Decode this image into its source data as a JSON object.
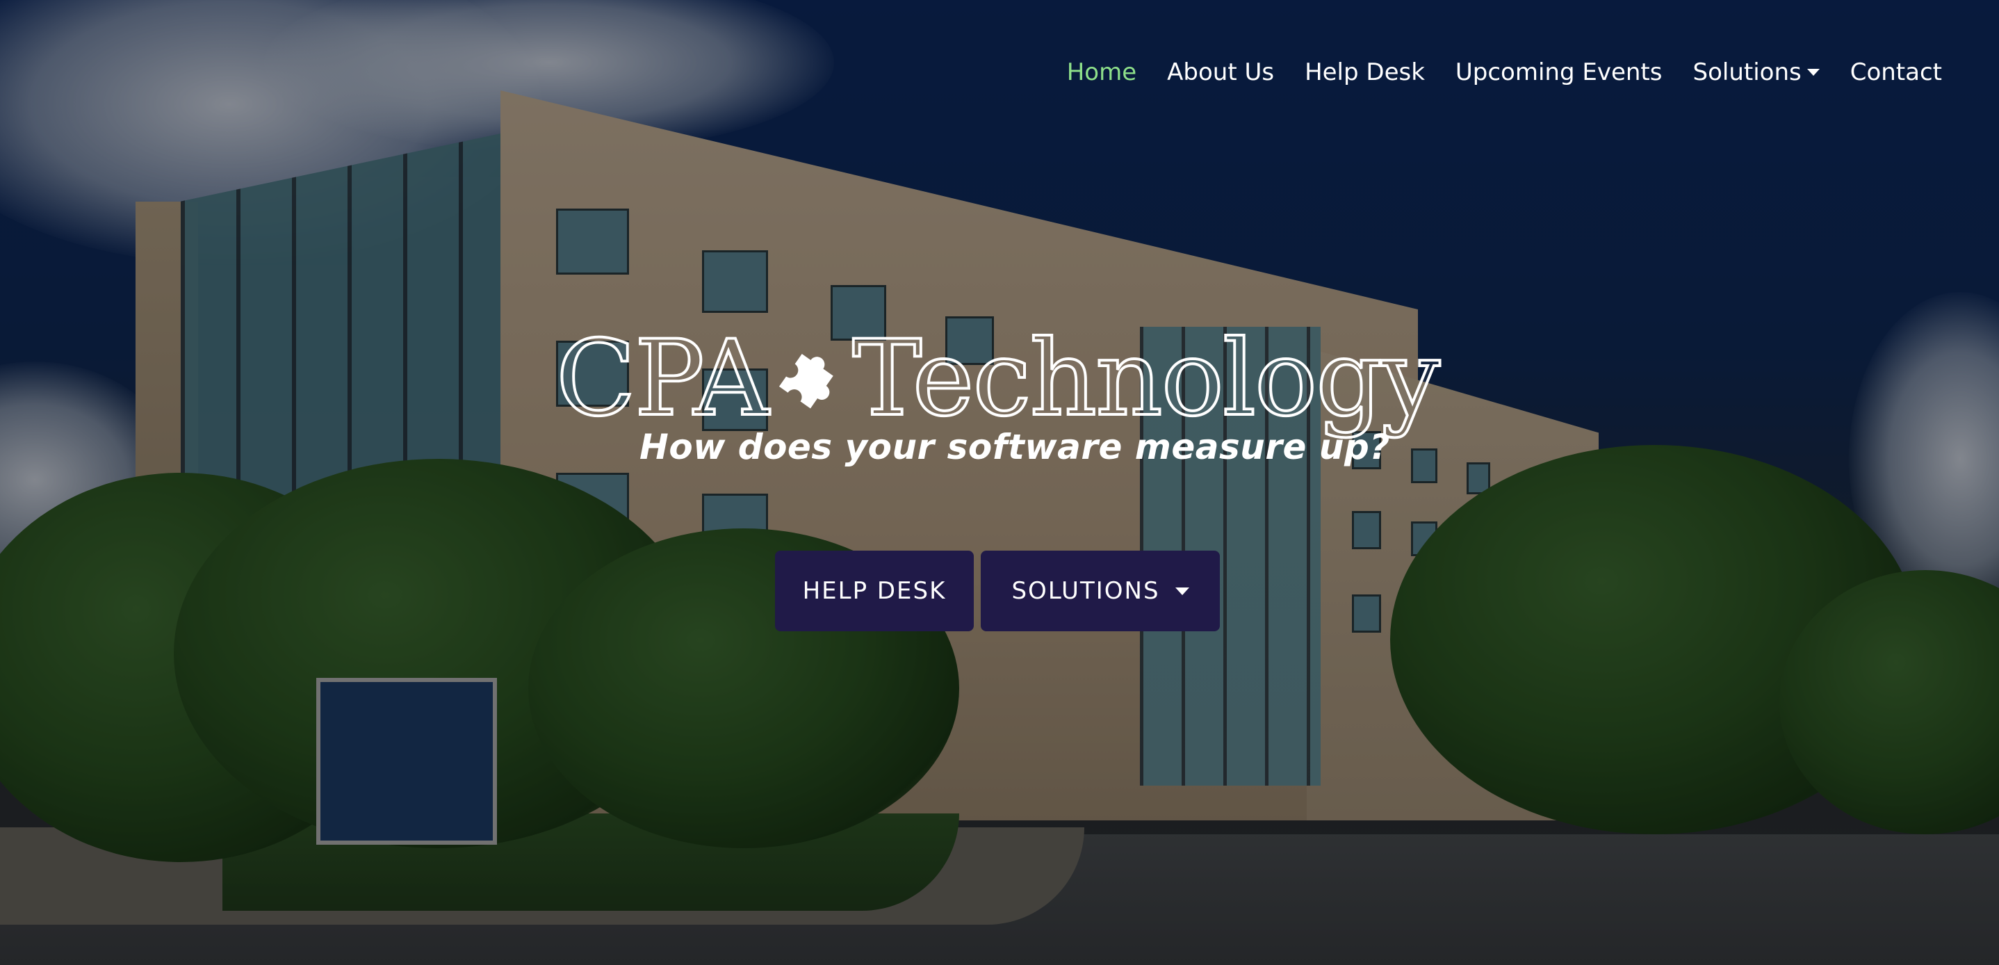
{
  "nav": {
    "items": [
      {
        "label": "Home",
        "active": true
      },
      {
        "label": "About Us"
      },
      {
        "label": "Help Desk"
      },
      {
        "label": "Upcoming Events"
      },
      {
        "label": "Solutions",
        "dropdown": true
      },
      {
        "label": "Contact"
      }
    ]
  },
  "logo": {
    "part1": "CPA",
    "part2": "Technology",
    "tagline": "How does your software measure up?",
    "icon": "puzzle-piece-icon"
  },
  "cta": {
    "help_desk_label": "HELP DESK",
    "solutions_label": "SOLUTIONS"
  },
  "colors": {
    "nav_active": "#8ee08a",
    "button_bg": "#201a48",
    "text": "#ffffff"
  }
}
